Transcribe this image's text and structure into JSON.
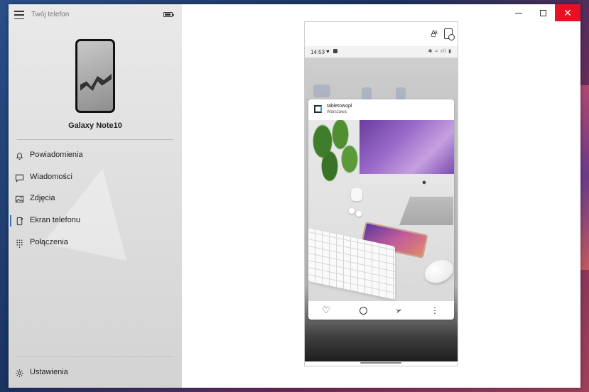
{
  "window": {
    "title": "Twój telefon",
    "controls": {
      "minimize": "minimize-icon",
      "maximize": "maximize-icon",
      "close": "close-icon"
    },
    "close_color": "#e81123"
  },
  "sidebar": {
    "device_name": "Galaxy Note10",
    "items": [
      {
        "label": "Powiadomienia",
        "icon": "bell-icon"
      },
      {
        "label": "Wiadomości",
        "icon": "message-icon"
      },
      {
        "label": "Zdjęcia",
        "icon": "photos-icon"
      },
      {
        "label": "Ekran telefonu",
        "icon": "phone-screen-icon",
        "active": true
      },
      {
        "label": "Połączenia",
        "icon": "dialpad-icon"
      }
    ],
    "settings_label": "Ustawienia",
    "accent": "#3a6fb0"
  },
  "phone": {
    "status_time": "14:53",
    "post": {
      "user": "tabletowopl",
      "location": "Warszawa"
    }
  }
}
